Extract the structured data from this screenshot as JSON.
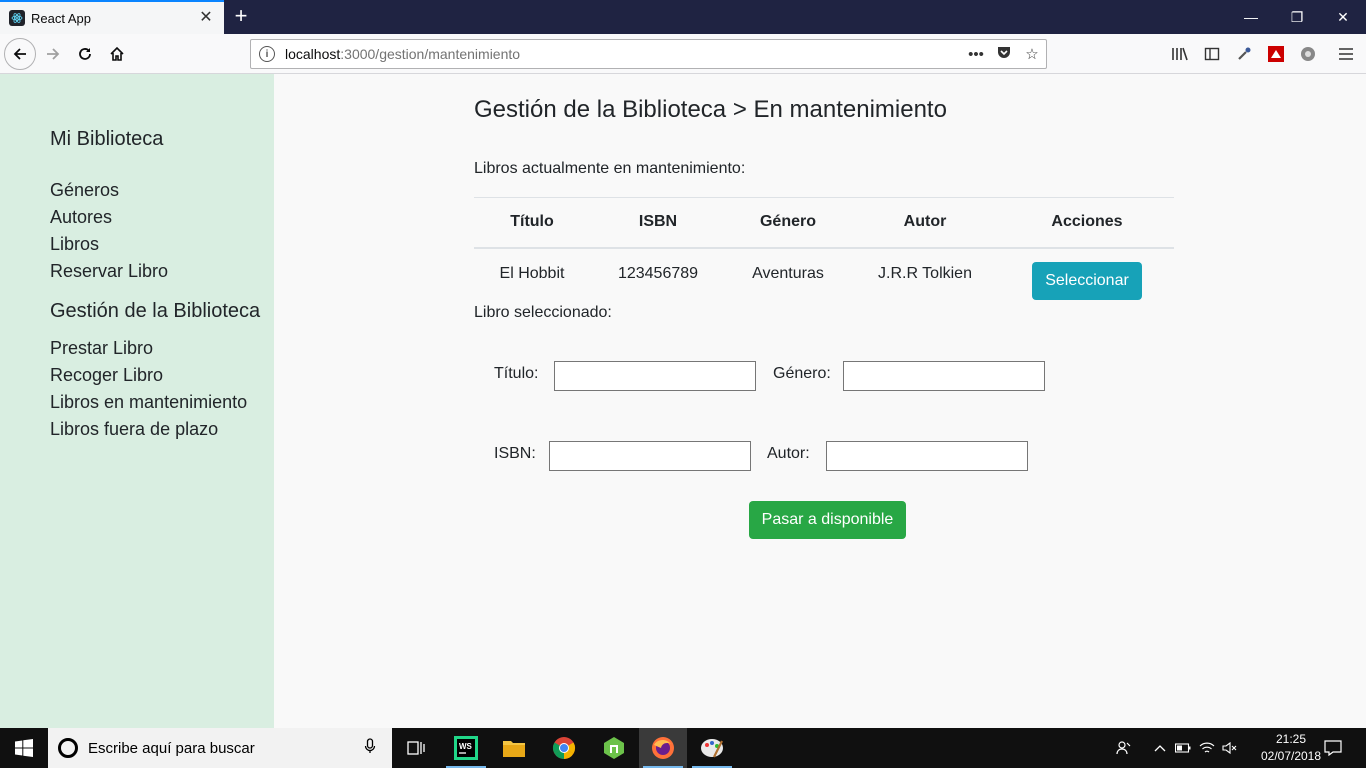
{
  "browser": {
    "tab_title": "React App",
    "tab_close": "✕",
    "new_tab": "+",
    "url_host": "localhost",
    "url_rest": ":3000/gestion/mantenimiento",
    "url_more": "•••",
    "window_controls": [
      "—",
      "❐",
      "✕"
    ]
  },
  "sidebar": {
    "brand": "Mi Biblioteca",
    "links": [
      "Géneros",
      "Autores",
      "Libros",
      "Reservar Libro"
    ],
    "section_title": "Gestión de la Biblioteca",
    "section_links": [
      "Prestar Libro",
      "Recoger Libro",
      "Libros en mantenimiento",
      "Libros fuera de plazo"
    ]
  },
  "main": {
    "title": "Gestión de la Biblioteca > En mantenimiento",
    "subtitle": "Libros actualmente en mantenimiento:",
    "table": {
      "headers": [
        "Título",
        "ISBN",
        "Género",
        "Autor",
        "Acciones"
      ],
      "rows": [
        {
          "titulo": "El Hobbit",
          "isbn": "123456789",
          "genero": "Aventuras",
          "autor": "J.R.R Tolkien",
          "action": "Seleccionar"
        }
      ]
    },
    "selected_label": "Libro seleccionado:",
    "form": {
      "titulo_label": "Título:",
      "genero_label": "Género:",
      "isbn_label": "ISBN:",
      "autor_label": "Autor:",
      "titulo_value": "",
      "genero_value": "",
      "isbn_value": "",
      "autor_value": ""
    },
    "submit": "Pasar a disponible"
  },
  "taskbar": {
    "search_placeholder": "Escribe aquí para buscar",
    "time": "21:25",
    "date": "02/07/2018"
  },
  "colors": {
    "sidebar_bg": "#d9eee1",
    "btn_info": "#17a2b8",
    "btn_success": "#28a745",
    "titlebar": "#1f2342"
  }
}
